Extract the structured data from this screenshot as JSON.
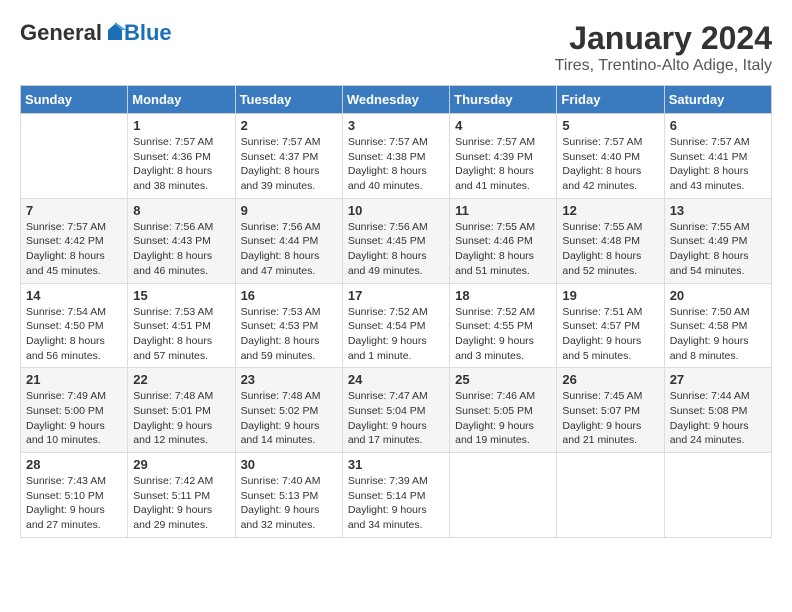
{
  "header": {
    "logo_general": "General",
    "logo_blue": "Blue",
    "month_title": "January 2024",
    "location": "Tires, Trentino-Alto Adige, Italy"
  },
  "weekdays": [
    "Sunday",
    "Monday",
    "Tuesday",
    "Wednesday",
    "Thursday",
    "Friday",
    "Saturday"
  ],
  "weeks": [
    [
      {
        "day": "",
        "info": ""
      },
      {
        "day": "1",
        "info": "Sunrise: 7:57 AM\nSunset: 4:36 PM\nDaylight: 8 hours\nand 38 minutes."
      },
      {
        "day": "2",
        "info": "Sunrise: 7:57 AM\nSunset: 4:37 PM\nDaylight: 8 hours\nand 39 minutes."
      },
      {
        "day": "3",
        "info": "Sunrise: 7:57 AM\nSunset: 4:38 PM\nDaylight: 8 hours\nand 40 minutes."
      },
      {
        "day": "4",
        "info": "Sunrise: 7:57 AM\nSunset: 4:39 PM\nDaylight: 8 hours\nand 41 minutes."
      },
      {
        "day": "5",
        "info": "Sunrise: 7:57 AM\nSunset: 4:40 PM\nDaylight: 8 hours\nand 42 minutes."
      },
      {
        "day": "6",
        "info": "Sunrise: 7:57 AM\nSunset: 4:41 PM\nDaylight: 8 hours\nand 43 minutes."
      }
    ],
    [
      {
        "day": "7",
        "info": "Sunrise: 7:57 AM\nSunset: 4:42 PM\nDaylight: 8 hours\nand 45 minutes."
      },
      {
        "day": "8",
        "info": "Sunrise: 7:56 AM\nSunset: 4:43 PM\nDaylight: 8 hours\nand 46 minutes."
      },
      {
        "day": "9",
        "info": "Sunrise: 7:56 AM\nSunset: 4:44 PM\nDaylight: 8 hours\nand 47 minutes."
      },
      {
        "day": "10",
        "info": "Sunrise: 7:56 AM\nSunset: 4:45 PM\nDaylight: 8 hours\nand 49 minutes."
      },
      {
        "day": "11",
        "info": "Sunrise: 7:55 AM\nSunset: 4:46 PM\nDaylight: 8 hours\nand 51 minutes."
      },
      {
        "day": "12",
        "info": "Sunrise: 7:55 AM\nSunset: 4:48 PM\nDaylight: 8 hours\nand 52 minutes."
      },
      {
        "day": "13",
        "info": "Sunrise: 7:55 AM\nSunset: 4:49 PM\nDaylight: 8 hours\nand 54 minutes."
      }
    ],
    [
      {
        "day": "14",
        "info": "Sunrise: 7:54 AM\nSunset: 4:50 PM\nDaylight: 8 hours\nand 56 minutes."
      },
      {
        "day": "15",
        "info": "Sunrise: 7:53 AM\nSunset: 4:51 PM\nDaylight: 8 hours\nand 57 minutes."
      },
      {
        "day": "16",
        "info": "Sunrise: 7:53 AM\nSunset: 4:53 PM\nDaylight: 8 hours\nand 59 minutes."
      },
      {
        "day": "17",
        "info": "Sunrise: 7:52 AM\nSunset: 4:54 PM\nDaylight: 9 hours\nand 1 minute."
      },
      {
        "day": "18",
        "info": "Sunrise: 7:52 AM\nSunset: 4:55 PM\nDaylight: 9 hours\nand 3 minutes."
      },
      {
        "day": "19",
        "info": "Sunrise: 7:51 AM\nSunset: 4:57 PM\nDaylight: 9 hours\nand 5 minutes."
      },
      {
        "day": "20",
        "info": "Sunrise: 7:50 AM\nSunset: 4:58 PM\nDaylight: 9 hours\nand 8 minutes."
      }
    ],
    [
      {
        "day": "21",
        "info": "Sunrise: 7:49 AM\nSunset: 5:00 PM\nDaylight: 9 hours\nand 10 minutes."
      },
      {
        "day": "22",
        "info": "Sunrise: 7:48 AM\nSunset: 5:01 PM\nDaylight: 9 hours\nand 12 minutes."
      },
      {
        "day": "23",
        "info": "Sunrise: 7:48 AM\nSunset: 5:02 PM\nDaylight: 9 hours\nand 14 minutes."
      },
      {
        "day": "24",
        "info": "Sunrise: 7:47 AM\nSunset: 5:04 PM\nDaylight: 9 hours\nand 17 minutes."
      },
      {
        "day": "25",
        "info": "Sunrise: 7:46 AM\nSunset: 5:05 PM\nDaylight: 9 hours\nand 19 minutes."
      },
      {
        "day": "26",
        "info": "Sunrise: 7:45 AM\nSunset: 5:07 PM\nDaylight: 9 hours\nand 21 minutes."
      },
      {
        "day": "27",
        "info": "Sunrise: 7:44 AM\nSunset: 5:08 PM\nDaylight: 9 hours\nand 24 minutes."
      }
    ],
    [
      {
        "day": "28",
        "info": "Sunrise: 7:43 AM\nSunset: 5:10 PM\nDaylight: 9 hours\nand 27 minutes."
      },
      {
        "day": "29",
        "info": "Sunrise: 7:42 AM\nSunset: 5:11 PM\nDaylight: 9 hours\nand 29 minutes."
      },
      {
        "day": "30",
        "info": "Sunrise: 7:40 AM\nSunset: 5:13 PM\nDaylight: 9 hours\nand 32 minutes."
      },
      {
        "day": "31",
        "info": "Sunrise: 7:39 AM\nSunset: 5:14 PM\nDaylight: 9 hours\nand 34 minutes."
      },
      {
        "day": "",
        "info": ""
      },
      {
        "day": "",
        "info": ""
      },
      {
        "day": "",
        "info": ""
      }
    ]
  ]
}
